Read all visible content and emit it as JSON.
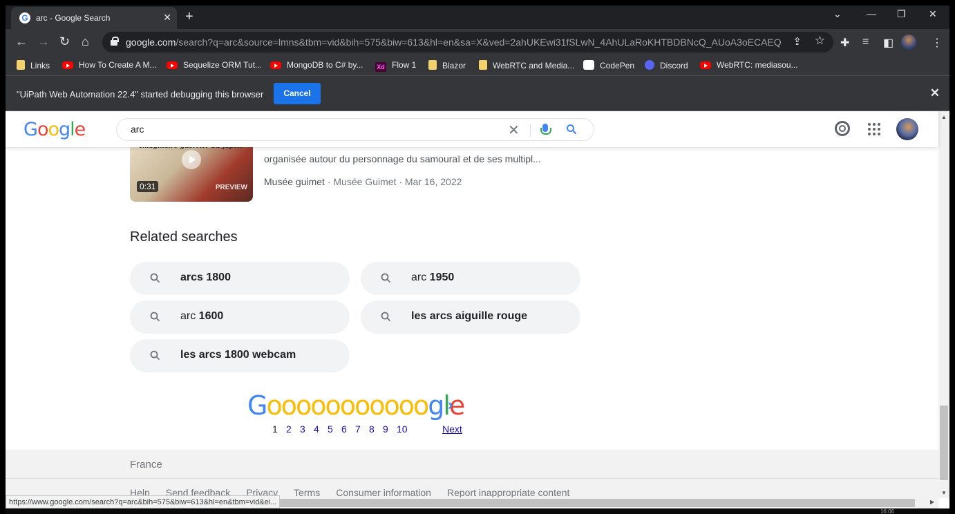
{
  "browser": {
    "tab_title": "arc - Google Search",
    "url_host": "google.com",
    "url_rest": "/search?q=arc&source=lmns&tbm=vid&bih=575&biw=613&hl=en&sa=X&ved=2ahUKEwi31fSLwN_4AhULaRoKHTBDBNcQ_AUoA3oECAEQ...",
    "bookmarks": [
      {
        "label": "Links",
        "icon": "folder-icon"
      },
      {
        "label": "How To Create A M...",
        "icon": "youtube-icon"
      },
      {
        "label": "Sequelize ORM Tut...",
        "icon": "youtube-icon"
      },
      {
        "label": "MongoDB to C# by...",
        "icon": "youtube-icon"
      },
      {
        "label": "Flow 1",
        "icon": "xd-icon",
        "icon_text": "Xd"
      },
      {
        "label": "Blazor",
        "icon": "folder-icon"
      },
      {
        "label": "WebRTC and Media...",
        "icon": "folder-icon"
      },
      {
        "label": "CodePen",
        "icon": "codepen-icon"
      },
      {
        "label": "Discord",
        "icon": "discord-icon"
      },
      {
        "label": "WebRTC: mediasou...",
        "icon": "youtube-icon"
      }
    ]
  },
  "infobar": {
    "message": "\"UiPath Web Automation 22.4\" started debugging this browser",
    "cancel_label": "Cancel"
  },
  "search": {
    "query": "arc"
  },
  "video_result": {
    "thumb_caption": "Imaginaire guerrier du Japon",
    "duration": "0:31",
    "preview_label": "PREVIEW",
    "snippet": "organisée autour du personnage du samouraï et de ses multipl...",
    "source": "Musée guimet",
    "channel": "Musée Guimet",
    "date": "Mar 16, 2022",
    "separator": " · "
  },
  "related": {
    "title": "Related searches",
    "items": [
      {
        "plain": "",
        "bold": "arcs 1800"
      },
      {
        "plain": "arc ",
        "bold": "1950"
      },
      {
        "plain": "arc ",
        "bold": "1600"
      },
      {
        "plain": "",
        "bold": "les arcs aiguille rouge"
      },
      {
        "plain": "",
        "bold": "les arcs 1800 webcam"
      }
    ]
  },
  "pagination": {
    "pages": [
      "1",
      "2",
      "3",
      "4",
      "5",
      "6",
      "7",
      "8",
      "9",
      "10"
    ],
    "current": "1",
    "next_label": "Next"
  },
  "footer": {
    "country": "France",
    "links": [
      "Help",
      "Send feedback",
      "Privacy",
      "Terms",
      "Consumer information",
      "Report inappropriate content"
    ]
  },
  "status_url": "https://www.google.com/search?q=arc&bih=575&biw=613&hl=en&tbm=vid&ei...",
  "clock": "16:06"
}
